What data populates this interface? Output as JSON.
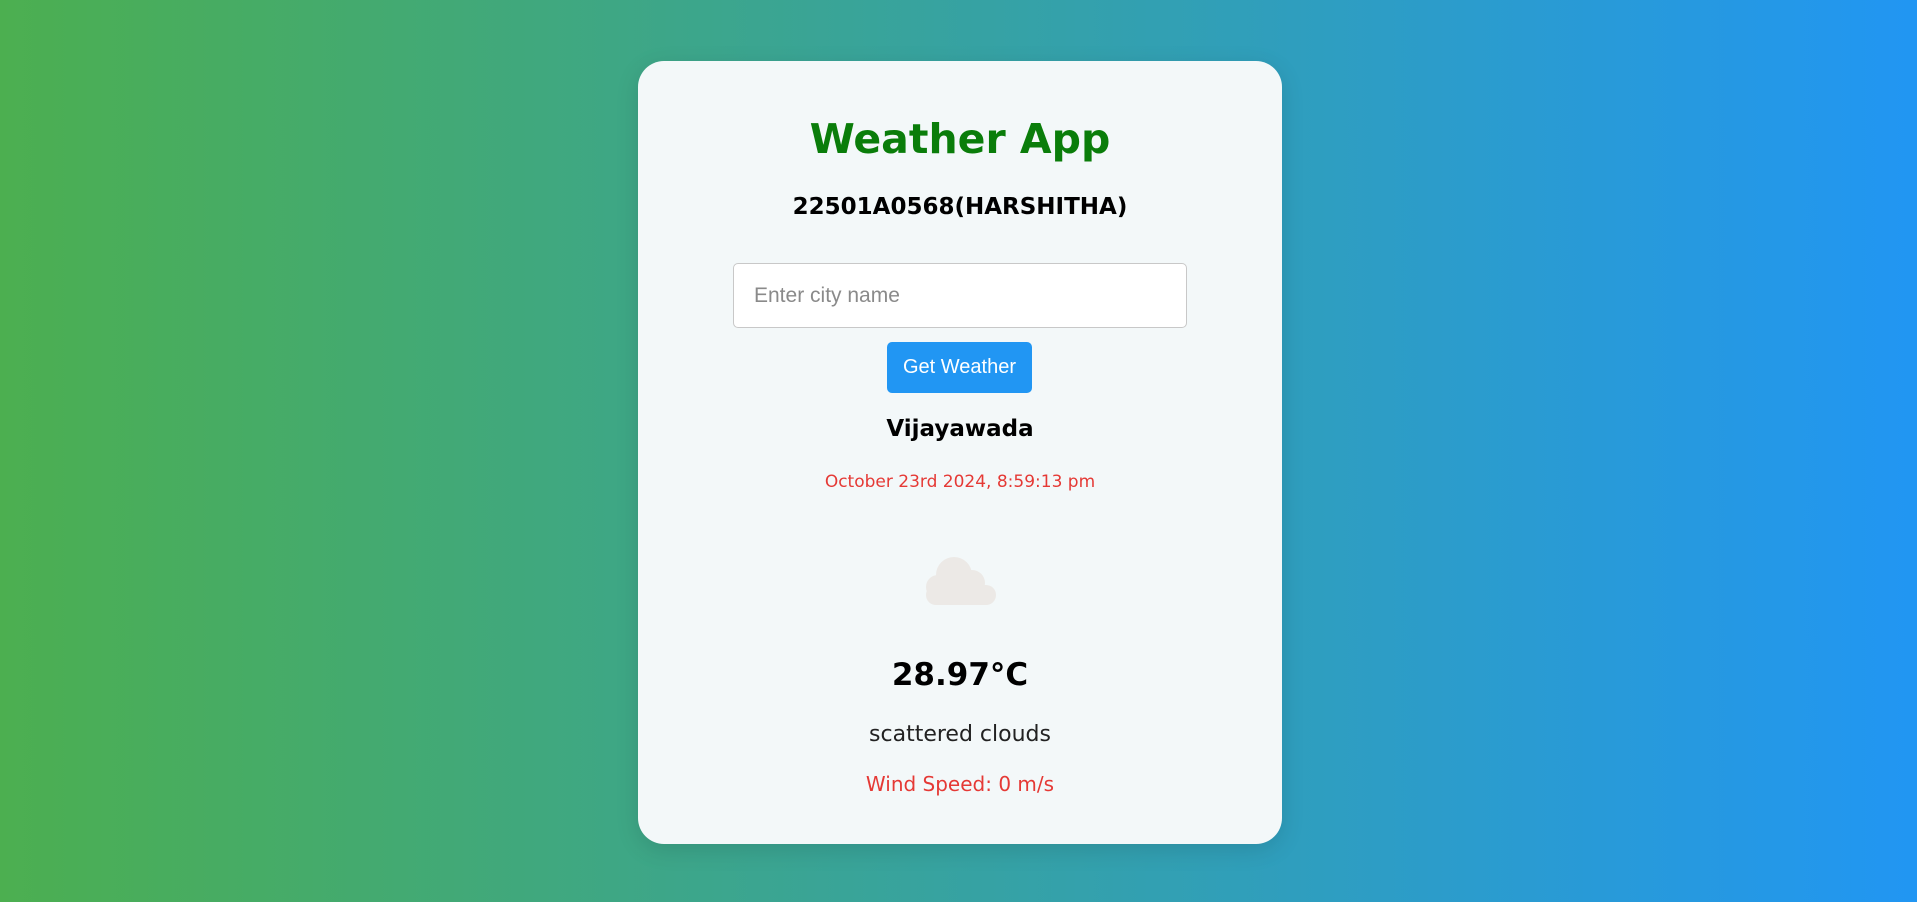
{
  "app": {
    "title": "Weather App",
    "student_id": "22501A0568(HARSHITHA)"
  },
  "search": {
    "placeholder": "Enter city name",
    "value": "",
    "button_label": "Get Weather"
  },
  "weather": {
    "city": "Vijayawada",
    "datetime": "October 23rd 2024, 8:59:13 pm",
    "icon": "cloud-icon",
    "temperature": "28.97°C",
    "description": "scattered clouds",
    "wind": "Wind Speed: 0 m/s"
  },
  "colors": {
    "gradient_start": "#4caf50",
    "gradient_end": "#2196f3",
    "title": "#0a7d0a",
    "button": "#2196f3",
    "accent_red": "#e53935",
    "card": "#f3f8f9"
  }
}
